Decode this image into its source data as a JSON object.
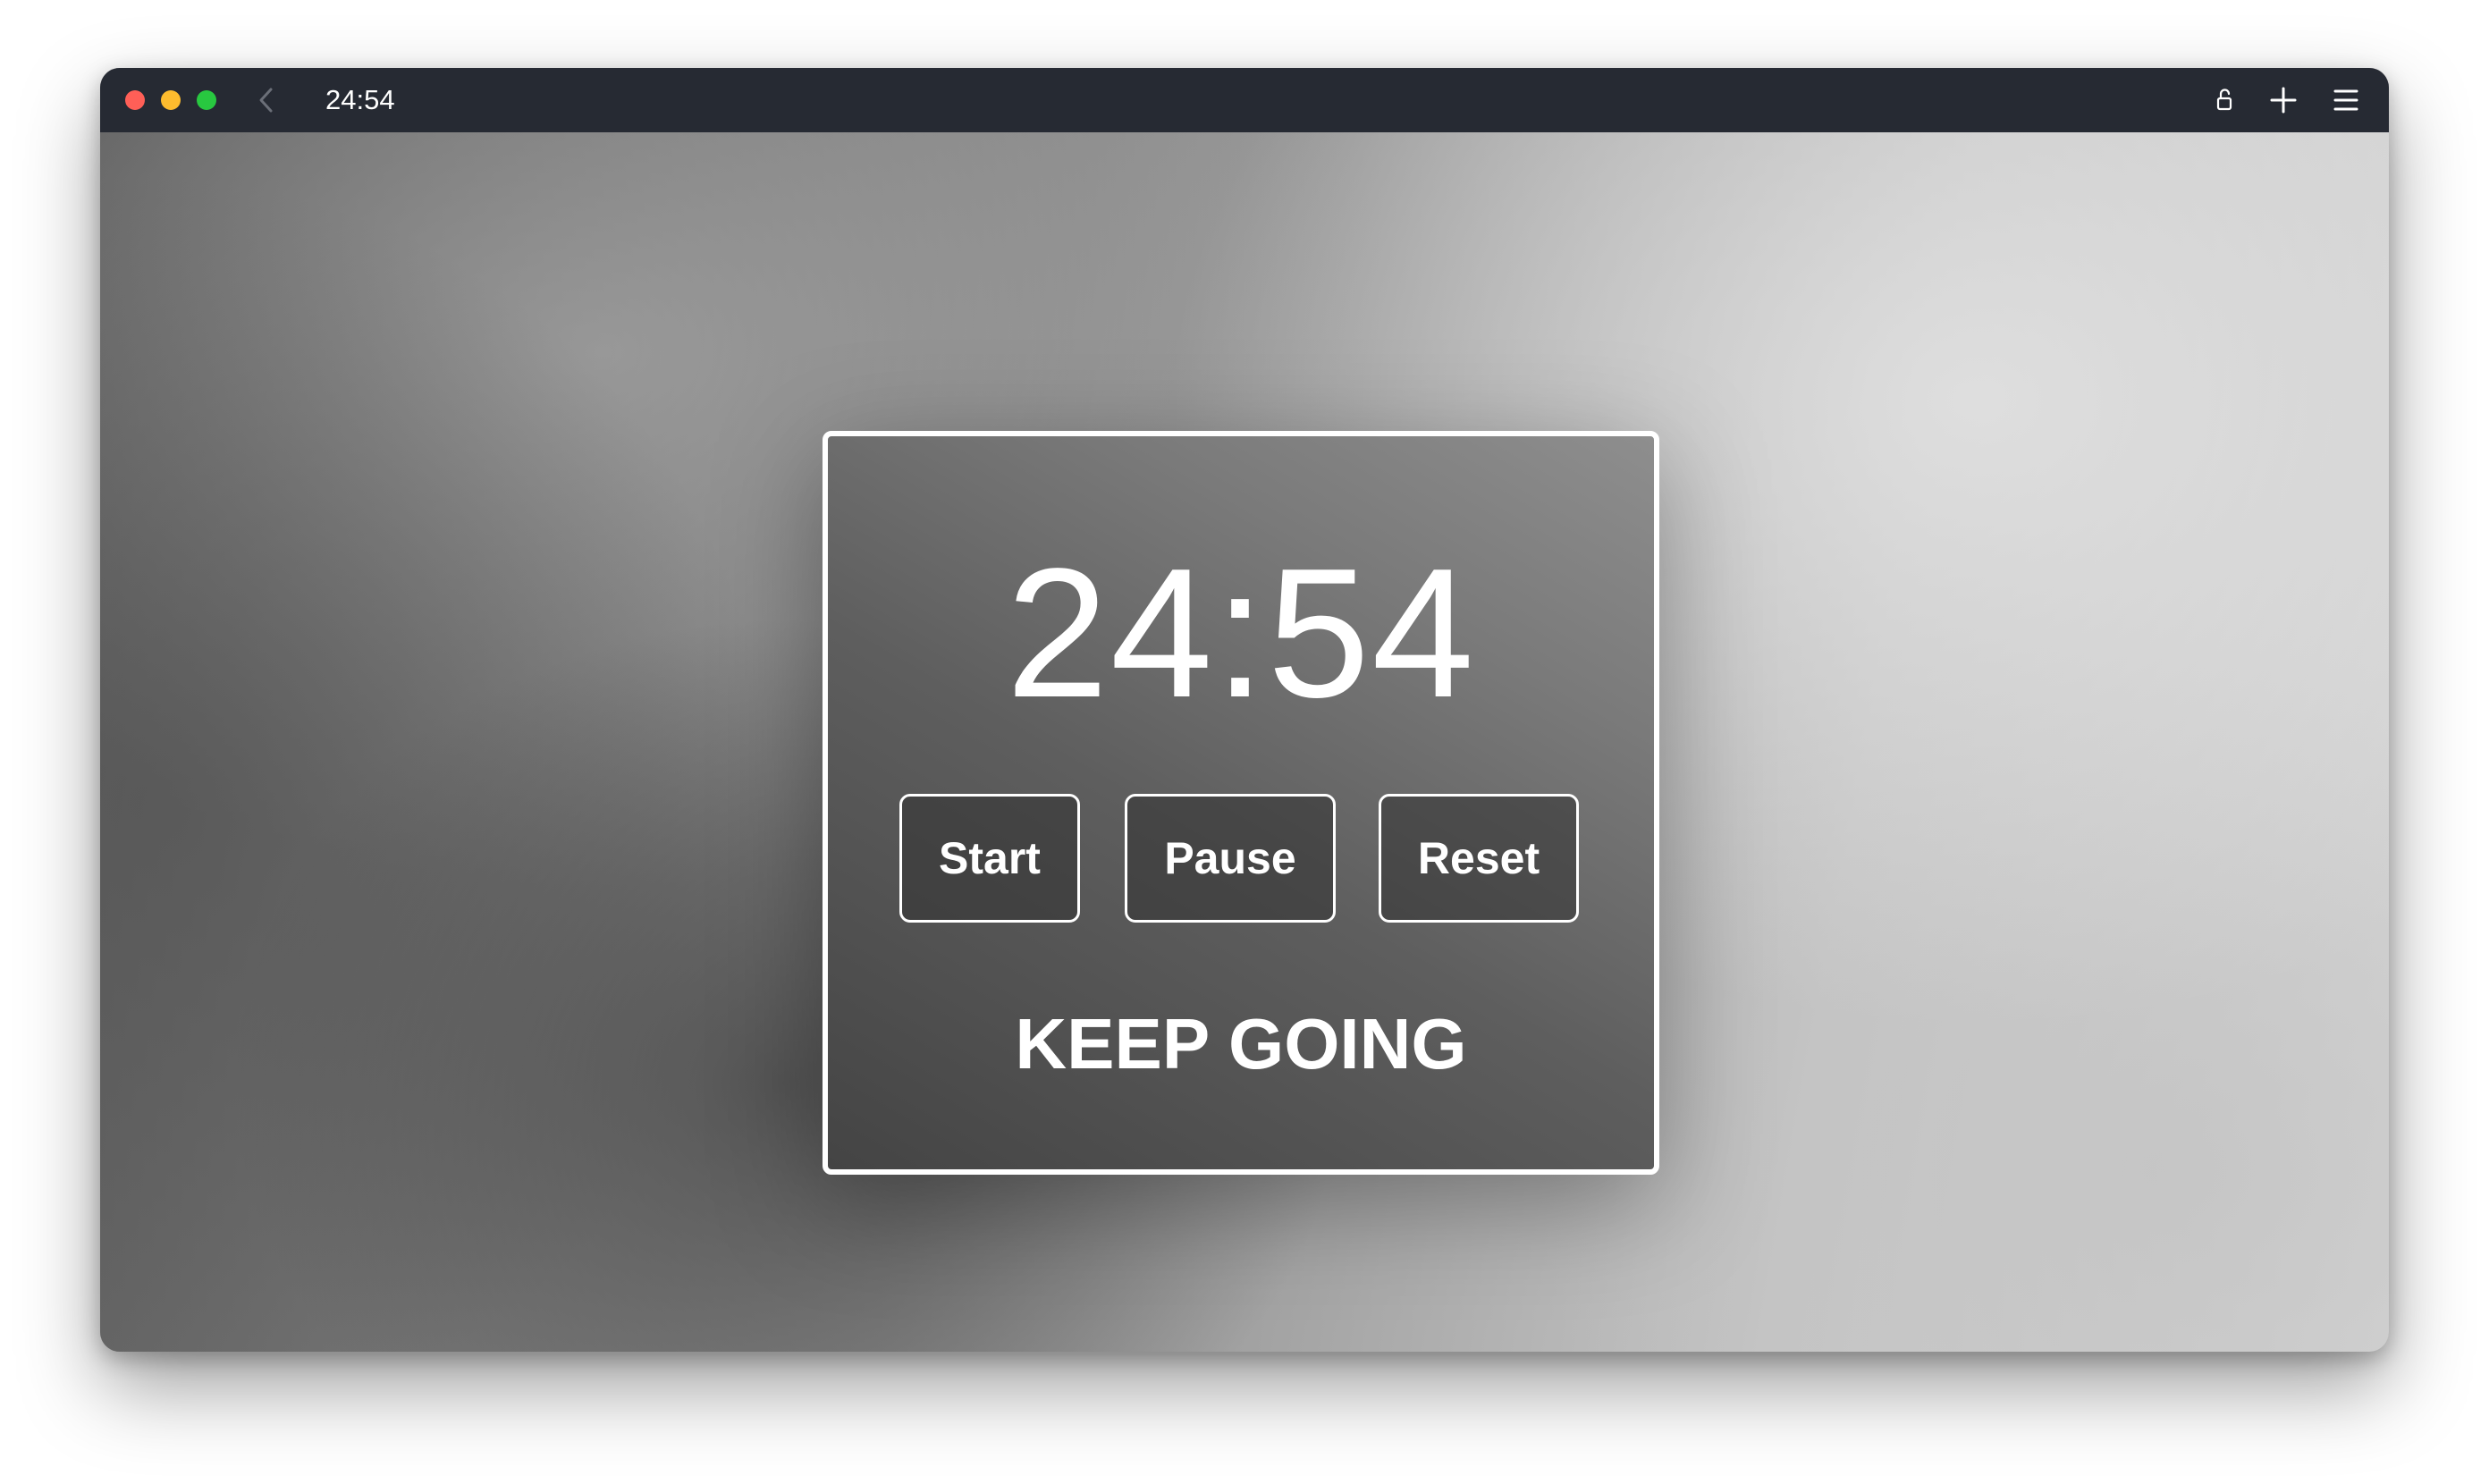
{
  "window": {
    "title": "24:54",
    "icons": {
      "back": "chevron-left-icon",
      "lock": "lock-icon",
      "new_tab": "plus-icon",
      "menu": "hamburger-menu-icon"
    },
    "traffic_light_colors": {
      "close": "#ff5f57",
      "minimize": "#febc2e",
      "maximize": "#28c840"
    }
  },
  "timer": {
    "display": "24:54"
  },
  "controls": {
    "start_label": "Start",
    "pause_label": "Pause",
    "reset_label": "Reset"
  },
  "status": {
    "message": "KEEP GOING"
  },
  "colors": {
    "titlebar": "#262a33",
    "text": "#ffffff",
    "panel_border": "#ffffff"
  }
}
